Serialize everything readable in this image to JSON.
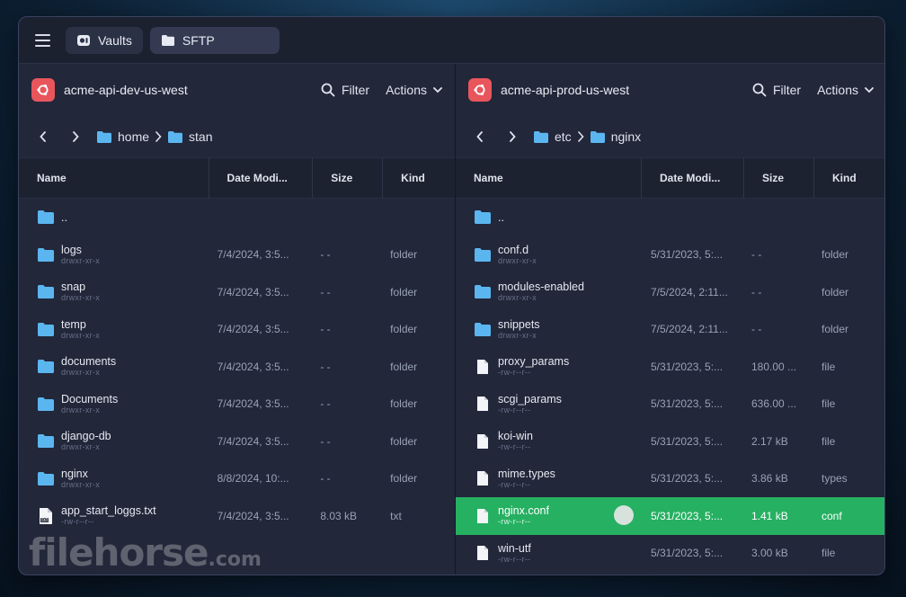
{
  "titlebar": {
    "tabs": [
      {
        "label": "Vaults"
      },
      {
        "label": "SFTP"
      }
    ]
  },
  "columns": {
    "name": "Name",
    "date": "Date Modi...",
    "size": "Size",
    "kind": "Kind"
  },
  "left": {
    "server": "acme-api-dev-us-west",
    "filter": "Filter",
    "actions": "Actions",
    "breadcrumb": [
      "home",
      "stan"
    ],
    "rows": [
      {
        "name": "..",
        "perm": "",
        "date": "",
        "size": "",
        "kind": "",
        "type": "folder"
      },
      {
        "name": "logs",
        "perm": "drwxr-xr-x",
        "date": "7/4/2024, 3:5...",
        "size": "- -",
        "kind": "folder",
        "type": "folder"
      },
      {
        "name": "snap",
        "perm": "drwxr-xr-x",
        "date": "7/4/2024, 3:5...",
        "size": "- -",
        "kind": "folder",
        "type": "folder"
      },
      {
        "name": "temp",
        "perm": "drwxr-xr-x",
        "date": "7/4/2024, 3:5...",
        "size": "- -",
        "kind": "folder",
        "type": "folder"
      },
      {
        "name": "documents",
        "perm": "drwxr-xr-x",
        "date": "7/4/2024, 3:5...",
        "size": "- -",
        "kind": "folder",
        "type": "folder"
      },
      {
        "name": "Documents",
        "perm": "drwxr-xr-x",
        "date": "7/4/2024, 3:5...",
        "size": "- -",
        "kind": "folder",
        "type": "folder"
      },
      {
        "name": "django-db",
        "perm": "drwxr-xr-x",
        "date": "7/4/2024, 3:5...",
        "size": "- -",
        "kind": "folder",
        "type": "folder"
      },
      {
        "name": "nginx",
        "perm": "drwxr-xr-x",
        "date": "8/8/2024, 10:...",
        "size": "- -",
        "kind": "folder",
        "type": "folder"
      },
      {
        "name": "app_start_loggs.txt",
        "perm": "-rw-r--r--",
        "date": "7/4/2024, 3:5...",
        "size": "8.03 kB",
        "kind": "txt",
        "type": "txt"
      }
    ]
  },
  "right": {
    "server": "acme-api-prod-us-west",
    "filter": "Filter",
    "actions": "Actions",
    "breadcrumb": [
      "etc",
      "nginx"
    ],
    "rows": [
      {
        "name": "..",
        "perm": "",
        "date": "",
        "size": "",
        "kind": "",
        "type": "folder"
      },
      {
        "name": "conf.d",
        "perm": "drwxr-xr-x",
        "date": "5/31/2023, 5:...",
        "size": "- -",
        "kind": "folder",
        "type": "folder"
      },
      {
        "name": "modules-enabled",
        "perm": "drwxr-xr-x",
        "date": "7/5/2024, 2:11...",
        "size": "- -",
        "kind": "folder",
        "type": "folder"
      },
      {
        "name": "snippets",
        "perm": "drwxr-xr-x",
        "date": "7/5/2024, 2:11...",
        "size": "- -",
        "kind": "folder",
        "type": "folder"
      },
      {
        "name": "proxy_params",
        "perm": "-rw-r--r--",
        "date": "5/31/2023, 5:...",
        "size": "180.00 ...",
        "kind": "file",
        "type": "file"
      },
      {
        "name": "scgi_params",
        "perm": "-rw-r--r--",
        "date": "5/31/2023, 5:...",
        "size": "636.00 ...",
        "kind": "file",
        "type": "file"
      },
      {
        "name": "koi-win",
        "perm": "-rw-r--r--",
        "date": "5/31/2023, 5:...",
        "size": "2.17 kB",
        "kind": "file",
        "type": "file"
      },
      {
        "name": "mime.types",
        "perm": "-rw-r--r--",
        "date": "5/31/2023, 5:...",
        "size": "3.86 kB",
        "kind": "types",
        "type": "file"
      },
      {
        "name": "nginx.conf",
        "perm": "-rw-r--r--",
        "date": "5/31/2023, 5:...",
        "size": "1.41 kB",
        "kind": "conf",
        "type": "file",
        "selected": true
      },
      {
        "name": "win-utf",
        "perm": "-rw-r--r--",
        "date": "5/31/2023, 5:...",
        "size": "3.00 kB",
        "kind": "file",
        "type": "file"
      }
    ]
  },
  "watermark": {
    "main": "filehorse",
    "suffix": ".com"
  },
  "colors": {
    "folder": "#5bb6f0",
    "selected": "#26b062",
    "server": "#e8565c"
  }
}
